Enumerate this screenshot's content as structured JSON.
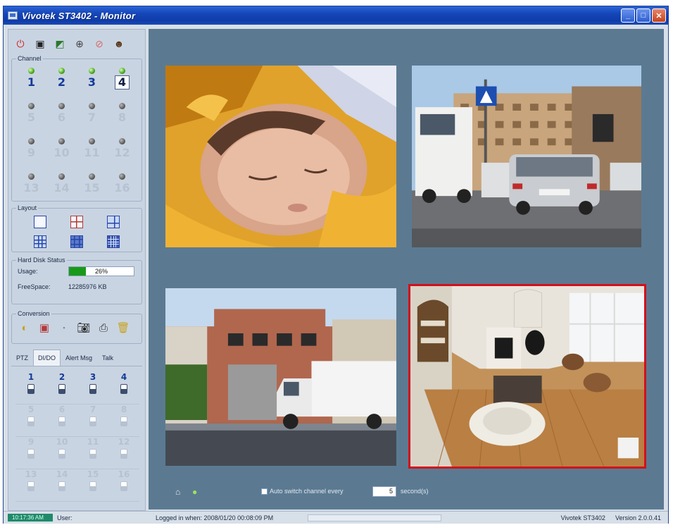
{
  "window": {
    "title": "Vivotek ST3402 - Monitor"
  },
  "toolbar": {
    "icons": [
      "power-icon",
      "display-icon",
      "color-icon",
      "network-icon",
      "clock-icon",
      "users-icon"
    ]
  },
  "channel": {
    "legend": "Channel",
    "items": [
      {
        "label": "1",
        "state": "on"
      },
      {
        "label": "2",
        "state": "on"
      },
      {
        "label": "3",
        "state": "on"
      },
      {
        "label": "4",
        "state": "selected"
      },
      {
        "label": "5",
        "state": "off"
      },
      {
        "label": "6",
        "state": "off"
      },
      {
        "label": "7",
        "state": "off"
      },
      {
        "label": "8",
        "state": "off"
      },
      {
        "label": "9",
        "state": "off"
      },
      {
        "label": "10",
        "state": "off"
      },
      {
        "label": "11",
        "state": "off"
      },
      {
        "label": "12",
        "state": "off"
      },
      {
        "label": "13",
        "state": "off"
      },
      {
        "label": "14",
        "state": "off"
      },
      {
        "label": "15",
        "state": "off"
      },
      {
        "label": "16",
        "state": "off"
      }
    ]
  },
  "layout": {
    "legend": "Layout",
    "options": [
      "single",
      "quad",
      "six",
      "nine",
      "ten",
      "sixteen"
    ]
  },
  "hard_disk": {
    "legend": "Hard Disk Status",
    "usage_label": "Usage:",
    "usage_value": "26%",
    "usage_fraction": 0.26,
    "free_label": "FreeSpace:",
    "free_value": "12285976 KB"
  },
  "conversion": {
    "legend": "Conversion",
    "icons": [
      "talk-icon",
      "record-icon",
      "snapshot-dot-icon",
      "camera-icon",
      "print-icon",
      "trash-icon"
    ]
  },
  "tabs": [
    {
      "label": "PTZ",
      "active": false
    },
    {
      "label": "DI/DO",
      "active": true
    },
    {
      "label": "Alert Msg",
      "active": false
    },
    {
      "label": "Talk",
      "active": false
    }
  ],
  "io": [
    {
      "label": "1",
      "active": true
    },
    {
      "label": "2",
      "active": true
    },
    {
      "label": "3",
      "active": true
    },
    {
      "label": "4",
      "active": true
    },
    {
      "label": "5",
      "active": false
    },
    {
      "label": "6",
      "active": false
    },
    {
      "label": "7",
      "active": false
    },
    {
      "label": "8",
      "active": false
    },
    {
      "label": "9",
      "active": false
    },
    {
      "label": "10",
      "active": false
    },
    {
      "label": "11",
      "active": false
    },
    {
      "label": "12",
      "active": false
    },
    {
      "label": "13",
      "active": false
    },
    {
      "label": "14",
      "active": false
    },
    {
      "label": "15",
      "active": false
    },
    {
      "label": "16",
      "active": false
    }
  ],
  "controls": {
    "auto_switch_label": "Auto switch channel every",
    "auto_switch_checked": false,
    "seconds_value": "5",
    "seconds_label": "second(s)"
  },
  "status": {
    "time": "10:17:36 AM",
    "user": "User:",
    "logged_in": "Logged in when: 2008/01/20 00:08:09 PM",
    "product": "Vivotek ST3402",
    "version": "Version 2.0.0.41"
  },
  "colors": {
    "accent": "#1546b8",
    "view_bg": "#5b7a92",
    "selected_border": "#d2101c",
    "sidebar_bg": "#c9d4e2"
  }
}
